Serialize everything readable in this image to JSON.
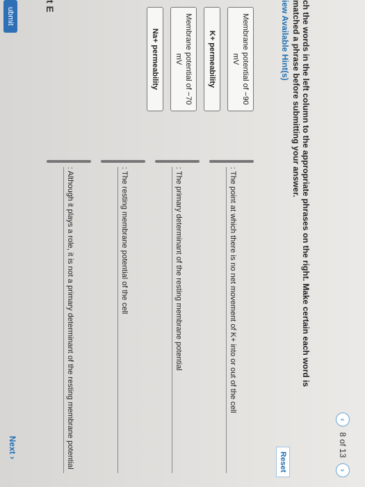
{
  "header": {
    "part_title": "t E",
    "counter": "8 of 13",
    "prev_icon": "chevron-left-icon",
    "next_icon": "chevron-right-icon"
  },
  "instructions": "ch the words in the left column to the appropriate phrases on the right. Make certain each word is matched a phrase before submitting your answer.",
  "hints_label": "iew Available Hint(s)",
  "reset_label": "Reset",
  "words": [
    "Membrane potential of −90 mV",
    "K+ permeability",
    "Membrane potential of −70 mV",
    "Na+ permeability"
  ],
  "phrases": [
    ": The point at which there is no net movement of K+ into or out of the cell",
    ": The primary determinant of the resting membrane potential",
    ": The resting membrane potential of the cell",
    ": Although it plays a role, it is not a primary determinant of the resting membrane potential"
  ],
  "buttons": {
    "submit": "ubmit",
    "next": "Next ›"
  }
}
